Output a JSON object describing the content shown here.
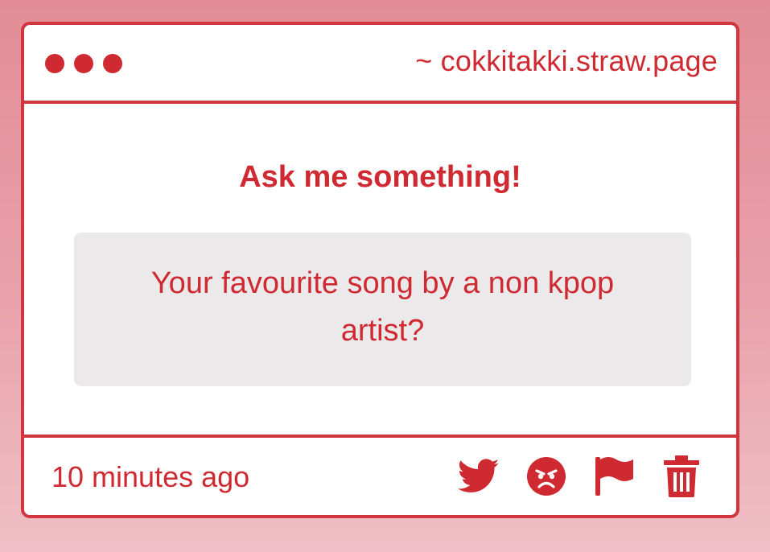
{
  "window": {
    "url": "~ cokkitakki.straw.page"
  },
  "main": {
    "prompt": "Ask me something!",
    "question": "Your favourite song by a non kpop artist?"
  },
  "footer": {
    "timestamp": "10 minutes ago",
    "actions": [
      {
        "icon": "twitter-icon"
      },
      {
        "icon": "angry-face-icon"
      },
      {
        "icon": "flag-icon"
      },
      {
        "icon": "trash-icon"
      }
    ]
  },
  "colors": {
    "accent": "#cf2a31",
    "border": "#d1353d",
    "question_bg": "#ebe9ea",
    "page_bg_top": "#e38c96",
    "page_bg_bottom": "#f0bfc6"
  }
}
